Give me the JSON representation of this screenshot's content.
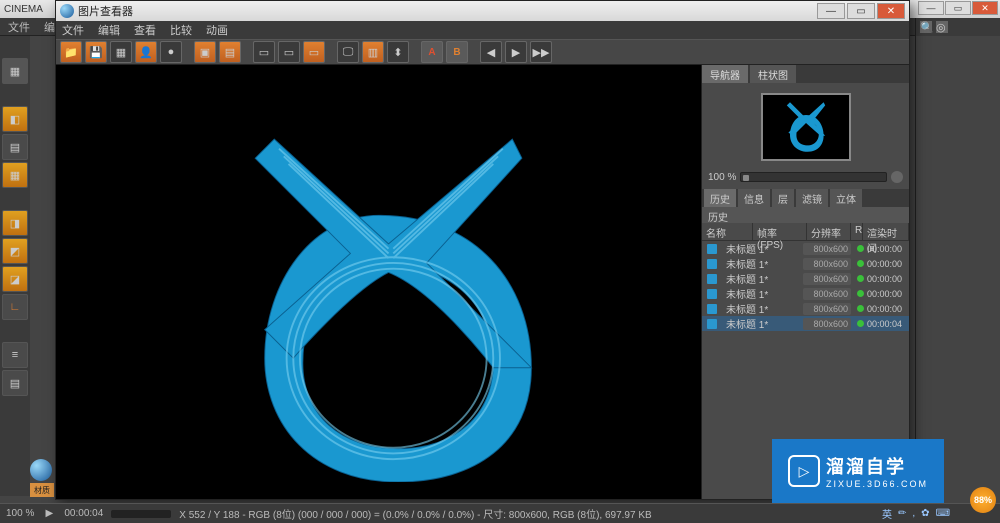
{
  "main": {
    "title": "CINEMA",
    "menu": [
      "文件",
      "编辑"
    ]
  },
  "viewer": {
    "title": "图片查看器",
    "menu": [
      "文件",
      "编辑",
      "查看",
      "比较",
      "动画"
    ],
    "side_tabs": {
      "navigator": "导航器",
      "histogram": "柱状图"
    },
    "zoom_label": "100 %",
    "hist_tabs": [
      "历史",
      "信息",
      "层",
      "滤镜",
      "立体"
    ],
    "hist_header": "历史",
    "cols": {
      "name": "名称",
      "fps": "帧率(FPS)",
      "res": "分辨率",
      "r": "R",
      "time": "渲染时间"
    },
    "rows": [
      {
        "name": "未标题 1*",
        "res": "800x600",
        "time": "00:00:00"
      },
      {
        "name": "未标题 1*",
        "res": "800x600",
        "time": "00:00:00"
      },
      {
        "name": "未标题 1*",
        "res": "800x600",
        "time": "00:00:00"
      },
      {
        "name": "未标题 1*",
        "res": "800x600",
        "time": "00:00:00"
      },
      {
        "name": "未标题 1*",
        "res": "800x600",
        "time": "00:00:00"
      },
      {
        "name": "未标题 1*",
        "res": "800x600",
        "time": "00:00:04"
      }
    ]
  },
  "status": {
    "zoom": "100 %",
    "time": "00:00:04",
    "info": "X 552 / Y 188 - RGB (8位) (000 / 000 / 000) = (0.0% / 0.0% / 0.0%) - 尺寸: 800x600, RGB (8位), 697.97 KB"
  },
  "c4d_label": "材质",
  "watermark": {
    "main": "溜溜自学",
    "sub": "ZIXUE.3D66.COM"
  },
  "coin": "88%",
  "ime": [
    "英",
    "✏",
    ",",
    "✿",
    "⌨"
  ]
}
